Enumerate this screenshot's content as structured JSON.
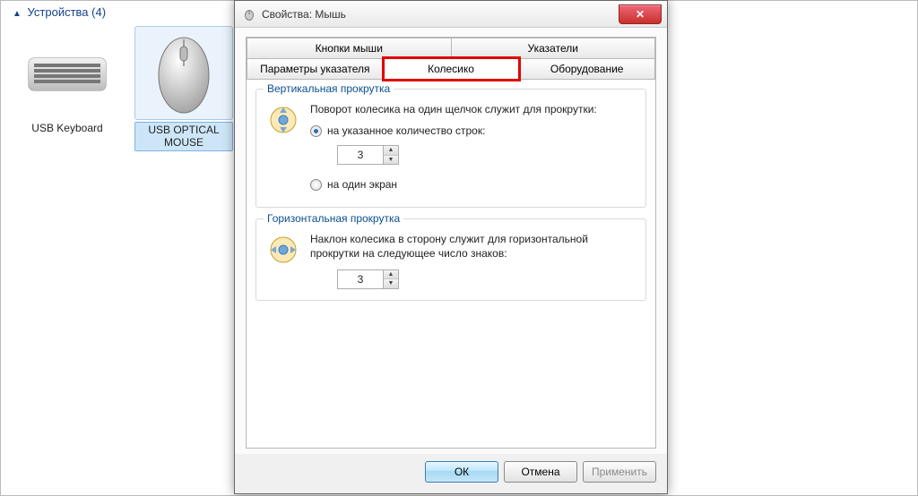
{
  "devices_panel": {
    "header": "Устройства (4)",
    "items": [
      {
        "label": "USB Keyboard",
        "selected": false
      },
      {
        "label": "USB OPTICAL MOUSE",
        "selected": true
      }
    ]
  },
  "dialog": {
    "title": "Свойства: Мышь",
    "tabs_row1": [
      "Кнопки мыши",
      "Указатели"
    ],
    "tabs_row2": [
      "Параметры указателя",
      "Колесико",
      "Оборудование"
    ],
    "active_tab": "Колесико",
    "vertical": {
      "group_title": "Вертикальная прокрутка",
      "desc": "Поворот колесика на один щелчок служит для прокрутки:",
      "option_lines": "на указанное количество строк:",
      "option_screen": "на один экран",
      "value": "3",
      "selected": "lines"
    },
    "horizontal": {
      "group_title": "Горизонтальная прокрутка",
      "desc": "Наклон колесика в сторону служит для горизонтальной прокрутки на следующее число знаков:",
      "value": "3"
    },
    "buttons": {
      "ok": "ОК",
      "cancel": "Отмена",
      "apply": "Применить"
    }
  }
}
